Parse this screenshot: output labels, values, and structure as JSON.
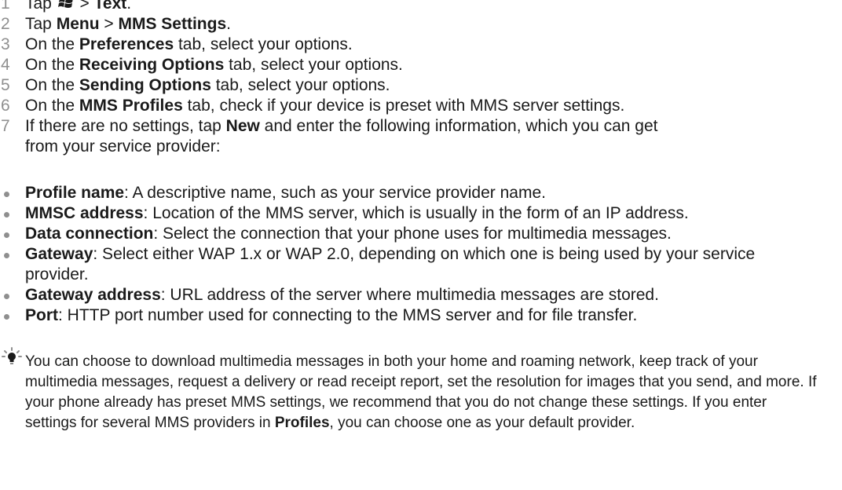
{
  "steps": [
    {
      "num": "1",
      "t1": "Tap ",
      "t2": " > ",
      "b1": "Text",
      "t3": "."
    },
    {
      "num": "2",
      "t1": "Tap ",
      "b1": "Menu",
      "t2": " > ",
      "b2": "MMS Settings",
      "t3": "."
    },
    {
      "num": "3",
      "t1": "On the ",
      "b1": "Preferences",
      "t2": " tab, select your options."
    },
    {
      "num": "4",
      "t1": "On the ",
      "b1": "Receiving Options",
      "t2": " tab, select your options."
    },
    {
      "num": "5",
      "t1": "On the ",
      "b1": "Sending Options",
      "t2": " tab, select your options."
    },
    {
      "num": "6",
      "t1": "On the ",
      "b1": "MMS Profiles",
      "t2": " tab, check if your device is preset with MMS server settings."
    },
    {
      "num": "7",
      "t1": "If there are no settings, tap ",
      "b1": "New",
      "t2": " and enter the following information, which you can get from your service provider:"
    }
  ],
  "fields": [
    {
      "name": "Profile name",
      "desc": ": A descriptive name, such as your service provider name."
    },
    {
      "name": "MMSC address",
      "desc": ": Location of the MMS server, which is usually in the form of an IP address."
    },
    {
      "name": "Data connection",
      "desc": ": Select the connection that your phone uses for multimedia messages."
    },
    {
      "name": "Gateway",
      "desc": ": Select either WAP 1.x or WAP 2.0, depending on which one is being used by your service provider."
    },
    {
      "name": "Gateway address",
      "desc": ": URL address of the server where multimedia messages are stored."
    },
    {
      "name": "Port",
      "desc": ": HTTP port number used for connecting to the MMS server and for file transfer."
    }
  ],
  "tip": {
    "icon": "lightbulb-icon",
    "text_before": "You can choose to download multimedia messages in both your home and roaming network, keep track of your multimedia messages, request a delivery or read receipt report, set the resolution for images that you send, and more. If your phone already has preset MMS settings, we recommend that you do not change these settings. If you enter settings for several MMS providers in ",
    "bold": "Profiles",
    "text_after": ", you can choose one as your default provider."
  },
  "colors": {
    "text": "#1a1a1a",
    "number": "#8f8f8f",
    "bullet": "#8f8f8f"
  }
}
